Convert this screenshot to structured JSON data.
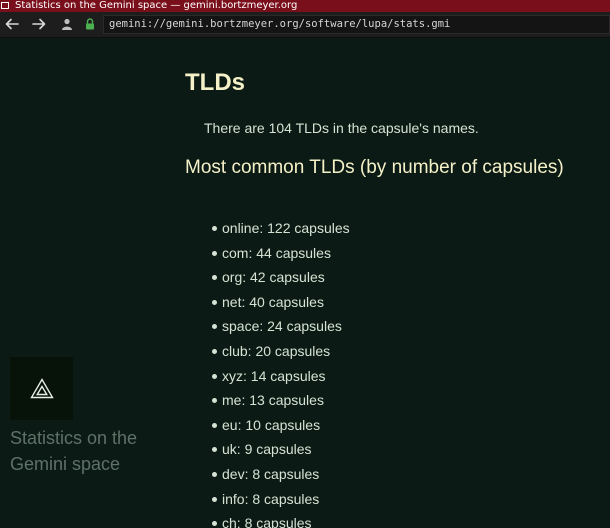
{
  "window": {
    "title": "Statistics on the Gemini space — gemini.bortzmeyer.org"
  },
  "toolbar": {
    "back_icon": "back-arrow-icon",
    "forward_icon": "forward-arrow-icon",
    "identity_icon": "user-icon",
    "secure_icon": "lock-icon",
    "url": "gemini://gemini.bortzmeyer.org/software/lupa/stats.gmi"
  },
  "sidebar": {
    "logo_icon": "gemini-triangle-icon",
    "title": "Statistics on the Gemini space"
  },
  "page": {
    "heading": "TLDs",
    "intro": "There are 104 TLDs in the capsule's names.",
    "subheading": "Most common TLDs (by number of capsules)",
    "tlds": [
      "online: 122 capsules",
      "com: 44 capsules",
      "org: 42 capsules",
      "net: 40 capsules",
      "space: 24 capsules",
      "club: 20 capsules",
      "xyz: 14 capsules",
      "me: 13 capsules",
      "eu: 10 capsules",
      "uk: 9 capsules",
      "dev: 8 capsules",
      "info: 8 capsules",
      "ch: 8 capsules"
    ]
  },
  "colors": {
    "background": "#0b1a14",
    "heading": "#f4f0c8",
    "text": "#d6e2d4",
    "titlebar": "#7a0f1c",
    "lock": "#4caf50"
  }
}
